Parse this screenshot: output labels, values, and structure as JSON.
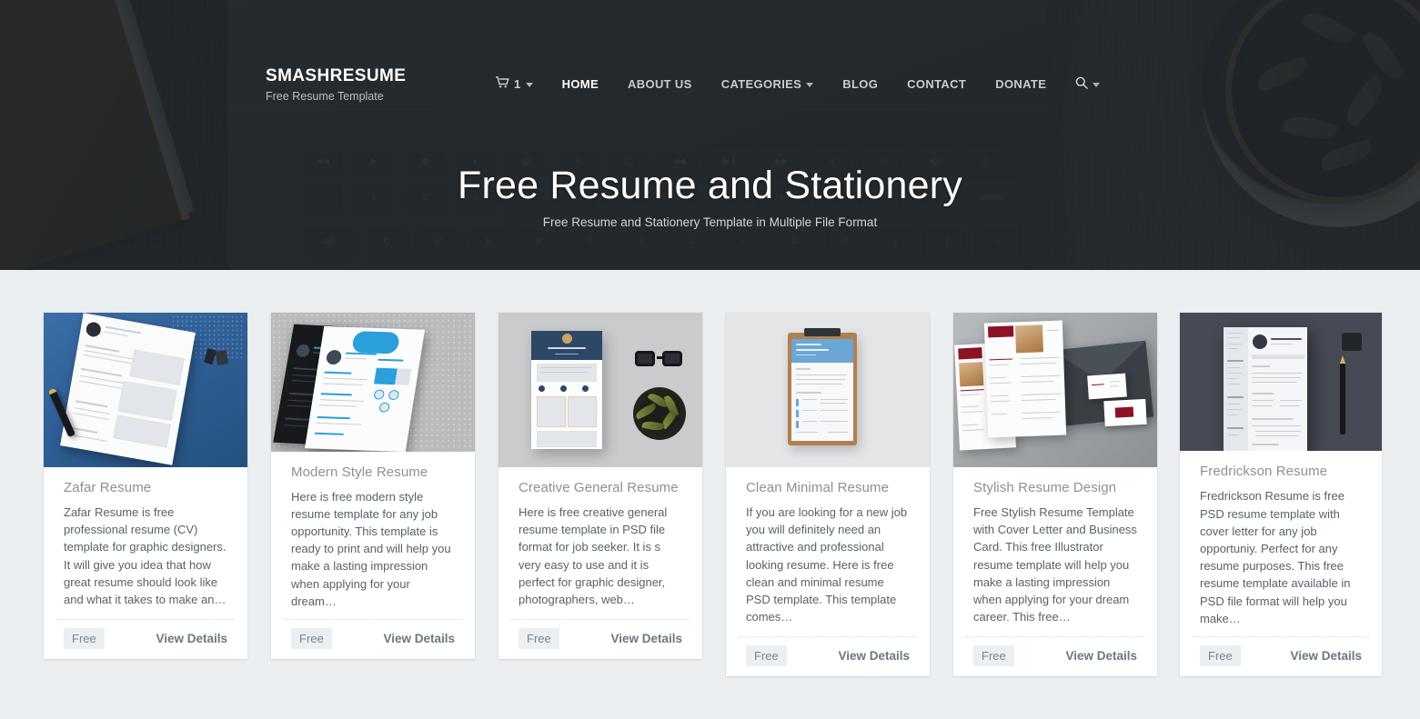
{
  "site": {
    "brand_title": "SMASHRESUME",
    "brand_tagline": "Free Resume Template"
  },
  "nav": {
    "cart_count": "1",
    "cart_icon": "shopping-cart-icon",
    "search_icon": "search-icon",
    "items": [
      {
        "label": "HOME",
        "active": true,
        "has_caret": false
      },
      {
        "label": "ABOUT US",
        "active": false,
        "has_caret": false
      },
      {
        "label": "CATEGORIES",
        "active": false,
        "has_caret": true
      },
      {
        "label": "BLOG",
        "active": false,
        "has_caret": false
      },
      {
        "label": "CONTACT",
        "active": false,
        "has_caret": false
      },
      {
        "label": "DONATE",
        "active": false,
        "has_caret": false
      }
    ]
  },
  "hero": {
    "title": "Free Resume and Stationery",
    "subtitle": "Free Resume and Stationery Template in Multiple File Format"
  },
  "colors": {
    "hero_overlay": "#212529",
    "page_background": "#eceff1",
    "card_background": "#ffffff",
    "title_text": "#8a9199",
    "body_text": "#59616a",
    "badge_background": "#eceff2",
    "link_text": "#6d7781"
  },
  "cards": [
    {
      "title": "Zafar Resume",
      "description": "Zafar Resume is free professional resume (CV) template for graphic designers. It will give you idea that how great resume should look like and what it takes to make an…",
      "price_badge": "Free",
      "details_label": "View Details",
      "thumb_alt": "resume-on-blue-desk-photo"
    },
    {
      "title": "Modern Style Resume",
      "description": "Here is free modern style resume template for any job opportunity. This template is ready to print and will help you make a lasting impression when applying for your dream…",
      "price_badge": "Free",
      "details_label": "View Details",
      "thumb_alt": "two-angled-resume-sheets-photo"
    },
    {
      "title": "Creative General Resume",
      "description": "Here is free creative general resume template in PSD file format for job seeker. It is s very easy to use and it is perfect for graphic designer, photographers, web…",
      "price_badge": "Free",
      "details_label": "View Details",
      "thumb_alt": "navy-resume-glasses-plant-photo"
    },
    {
      "title": "Clean Minimal Resume",
      "description": "If you are looking for a new job you will definitely need an attractive and professional looking resume. Here is free clean and minimal resume PSD template. This template comes…",
      "price_badge": "Free",
      "details_label": "View Details",
      "thumb_alt": "clipboard-resume-photo"
    },
    {
      "title": "Stylish Resume Design",
      "description": "Free Stylish Resume Template with Cover Letter and Business Card. This free Illustrator resume template will help you make a lasting impression when applying for your dream career. This free…",
      "price_badge": "Free",
      "details_label": "View Details",
      "thumb_alt": "resume-set-with-envelope-photo"
    },
    {
      "title": "Fredrickson Resume",
      "description": "Fredrickson Resume is free PSD resume template with cover letter for any job opportuniy. Perfect for any resume purposes. This free resume template available in PSD file format will help you make…",
      "price_badge": "Free",
      "details_label": "View Details",
      "thumb_alt": "dark-desk-resume-pencil-photo"
    }
  ]
}
